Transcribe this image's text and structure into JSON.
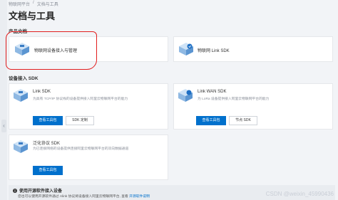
{
  "breadcrumb": {
    "parent": "物联网平台",
    "separator": "/",
    "current": "文档与工具"
  },
  "page": {
    "title": "文档与工具"
  },
  "product_docs": {
    "section_title": "产品文档",
    "cards": [
      {
        "title": "物联网设备接入与管理",
        "icon": "cube-device-icon"
      },
      {
        "title": "物联网 Link SDK",
        "icon": "cube-cloud-icon"
      }
    ]
  },
  "device_access": {
    "section_title": "设备接入 SDK",
    "cards": [
      {
        "title": "Link SDK",
        "desc": "为具有 TCP/IP 协议栈的设备提供接入阿里云物联网平台的能力",
        "primary_label": "查看工具包",
        "secondary_label": "SDK 定制",
        "icon": "cube-device-icon"
      },
      {
        "title": "Link WAN SDK",
        "desc": "为 LoRa 设备提供接入阿里云物联网平台的能力",
        "primary_label": "查看工具包",
        "secondary_label": "节点 SDK",
        "icon": "cube-cloud-icon"
      },
      {
        "title": "泛化协议 SDK",
        "desc": "为已连接网络的设备提供连接阿里云物联网平台的双向数据通道",
        "primary_label": "查看工具包",
        "icon": "cube-device-icon"
      }
    ]
  },
  "notice": {
    "title": "使用开源软件接入设备",
    "desc": "您也可以使用开源软件通过 Alink 协议将设备接入阿里云物联网平台, 查看",
    "link": "开源软件说明"
  },
  "watermark": "CSDN @weixin_45990436",
  "colors": {
    "primary": "#0070cc",
    "highlight": "#e21e1e"
  }
}
